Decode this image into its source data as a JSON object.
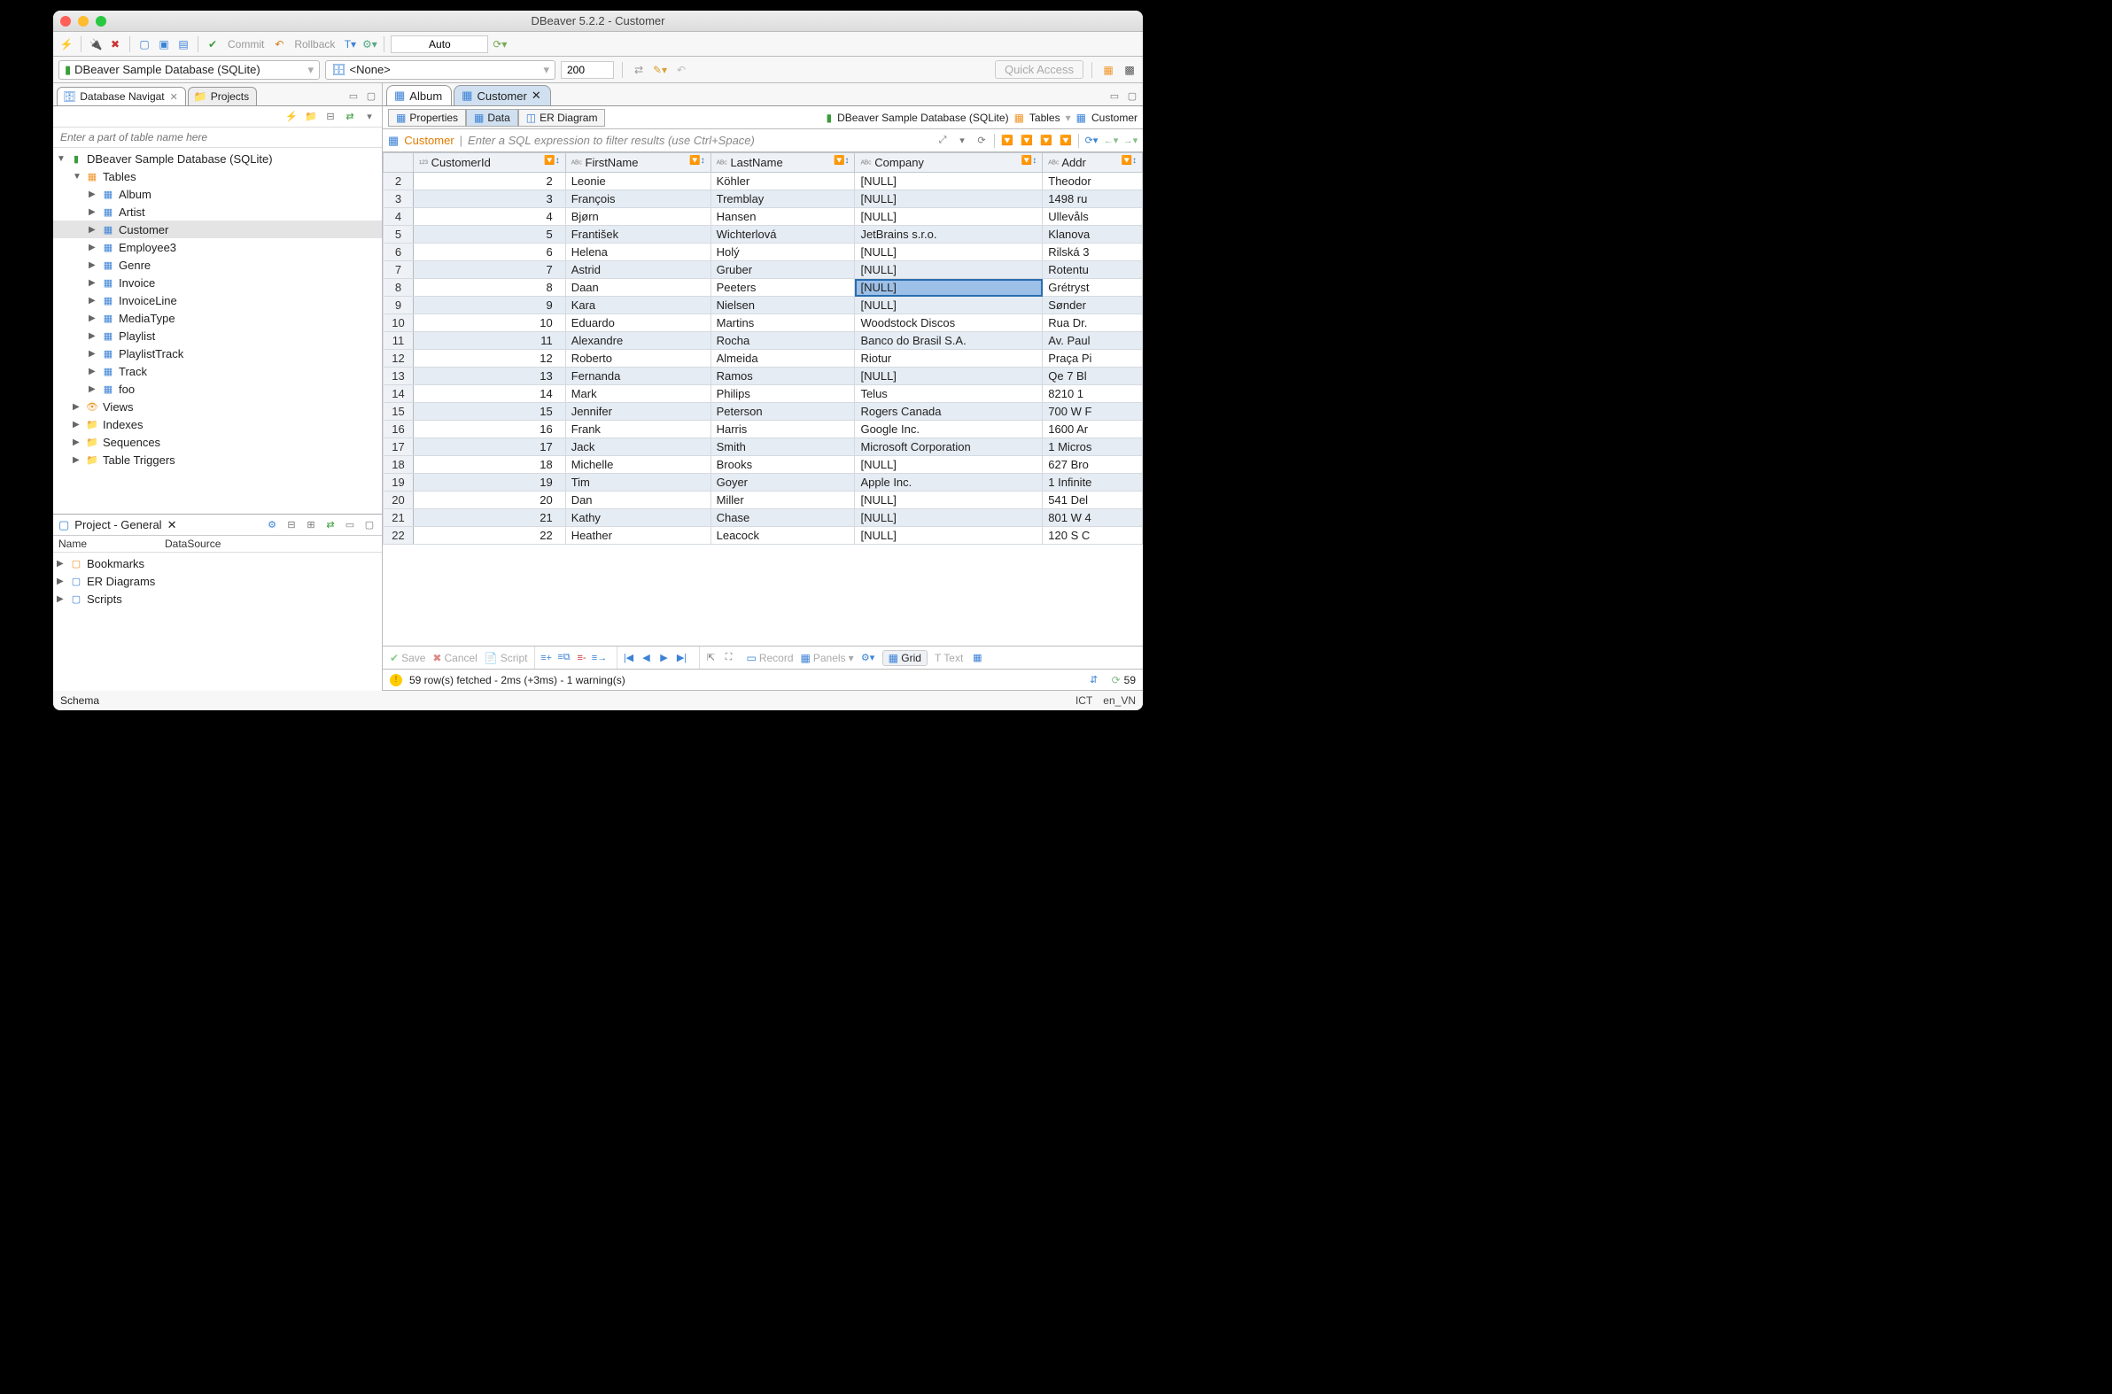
{
  "title": "DBeaver 5.2.2 - Customer",
  "toolbar": {
    "commit": "Commit",
    "rollback": "Rollback",
    "auto": "Auto",
    "limit": "200",
    "quick_access": "Quick Access"
  },
  "connection_combo": "DBeaver Sample Database (SQLite)",
  "schema_combo": "<None>",
  "left_tabs": {
    "nav": "Database Navigat",
    "projects": "Projects"
  },
  "filter_placeholder": "Enter a part of table name here",
  "tree": {
    "root": "DBeaver Sample Database (SQLite)",
    "tables_label": "Tables",
    "tables": [
      "Album",
      "Artist",
      "Customer",
      "Employee3",
      "Genre",
      "Invoice",
      "InvoiceLine",
      "MediaType",
      "Playlist",
      "PlaylistTrack",
      "Track",
      "foo"
    ],
    "views": "Views",
    "indexes": "Indexes",
    "sequences": "Sequences",
    "triggers": "Table Triggers"
  },
  "project_pane": {
    "title": "Project - General",
    "col_name": "Name",
    "col_ds": "DataSource",
    "items": [
      "Bookmarks",
      "ER Diagrams",
      "Scripts"
    ]
  },
  "editor": {
    "tabs": [
      {
        "label": "Album",
        "active": false
      },
      {
        "label": "Customer",
        "active": true
      }
    ],
    "subtabs": {
      "props": "Properties",
      "data": "Data",
      "er": "ER Diagram"
    },
    "breadcrumb": {
      "ds": "DBeaver Sample Database (SQLite)",
      "tables": "Tables",
      "table": "Customer"
    },
    "filter_label": "Customer",
    "filter_hint": "Enter a SQL expression to filter results (use Ctrl+Space)",
    "columns": [
      "CustomerId",
      "FirstName",
      "LastName",
      "Company",
      "Addr"
    ],
    "rows": [
      {
        "n": 2,
        "id": 2,
        "fn": "Leonie",
        "ln": "Köhler",
        "co": "[NULL]",
        "ad": "Theodor"
      },
      {
        "n": 3,
        "id": 3,
        "fn": "François",
        "ln": "Tremblay",
        "co": "[NULL]",
        "ad": "1498 ru"
      },
      {
        "n": 4,
        "id": 4,
        "fn": "Bjørn",
        "ln": "Hansen",
        "co": "[NULL]",
        "ad": "Ullevåls"
      },
      {
        "n": 5,
        "id": 5,
        "fn": "František",
        "ln": "Wichterlová",
        "co": "JetBrains s.r.o.",
        "ad": "Klanova"
      },
      {
        "n": 6,
        "id": 6,
        "fn": "Helena",
        "ln": "Holý",
        "co": "[NULL]",
        "ad": "Rilská 3"
      },
      {
        "n": 7,
        "id": 7,
        "fn": "Astrid",
        "ln": "Gruber",
        "co": "[NULL]",
        "ad": "Rotentu"
      },
      {
        "n": 8,
        "id": 8,
        "fn": "Daan",
        "ln": "Peeters",
        "co": "[NULL]",
        "ad": "Grétryst",
        "sel": true
      },
      {
        "n": 9,
        "id": 9,
        "fn": "Kara",
        "ln": "Nielsen",
        "co": "[NULL]",
        "ad": "Sønder"
      },
      {
        "n": 10,
        "id": 10,
        "fn": "Eduardo",
        "ln": "Martins",
        "co": "Woodstock Discos",
        "ad": "Rua Dr."
      },
      {
        "n": 11,
        "id": 11,
        "fn": "Alexandre",
        "ln": "Rocha",
        "co": "Banco do Brasil S.A.",
        "ad": "Av. Paul"
      },
      {
        "n": 12,
        "id": 12,
        "fn": "Roberto",
        "ln": "Almeida",
        "co": "Riotur",
        "ad": "Praça Pi"
      },
      {
        "n": 13,
        "id": 13,
        "fn": "Fernanda",
        "ln": "Ramos",
        "co": "[NULL]",
        "ad": "Qe 7 Bl"
      },
      {
        "n": 14,
        "id": 14,
        "fn": "Mark",
        "ln": "Philips",
        "co": "Telus",
        "ad": "8210 1"
      },
      {
        "n": 15,
        "id": 15,
        "fn": "Jennifer",
        "ln": "Peterson",
        "co": "Rogers Canada",
        "ad": "700 W F"
      },
      {
        "n": 16,
        "id": 16,
        "fn": "Frank",
        "ln": "Harris",
        "co": "Google Inc.",
        "ad": "1600 Ar"
      },
      {
        "n": 17,
        "id": 17,
        "fn": "Jack",
        "ln": "Smith",
        "co": "Microsoft Corporation",
        "ad": "1 Micros"
      },
      {
        "n": 18,
        "id": 18,
        "fn": "Michelle",
        "ln": "Brooks",
        "co": "[NULL]",
        "ad": "627 Bro"
      },
      {
        "n": 19,
        "id": 19,
        "fn": "Tim",
        "ln": "Goyer",
        "co": "Apple Inc.",
        "ad": "1 Infinite"
      },
      {
        "n": 20,
        "id": 20,
        "fn": "Dan",
        "ln": "Miller",
        "co": "[NULL]",
        "ad": "541 Del"
      },
      {
        "n": 21,
        "id": 21,
        "fn": "Kathy",
        "ln": "Chase",
        "co": "[NULL]",
        "ad": "801 W 4"
      },
      {
        "n": 22,
        "id": 22,
        "fn": "Heather",
        "ln": "Leacock",
        "co": "[NULL]",
        "ad": "120 S C"
      }
    ],
    "footer": {
      "save": "Save",
      "cancel": "Cancel",
      "script": "Script",
      "record": "Record",
      "panels": "Panels",
      "grid": "Grid",
      "text": "Text"
    },
    "status": "59 row(s) fetched - 2ms (+3ms) - 1 warning(s)",
    "count": "59"
  },
  "statusbar": {
    "schema": "Schema",
    "tz": "ICT",
    "locale": "en_VN"
  }
}
